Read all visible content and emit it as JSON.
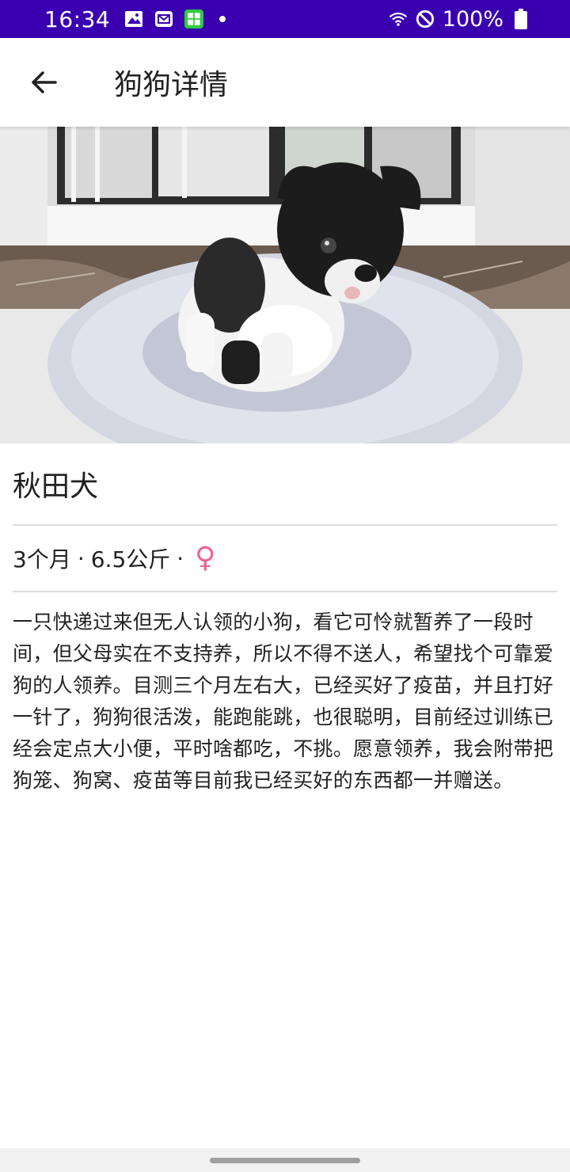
{
  "status_bar": {
    "time": "16:34",
    "battery": "100%",
    "background": "#3a00b0",
    "icons": [
      "image-icon",
      "mail-icon",
      "app-icon",
      "wifi-icon",
      "dnd-icon",
      "battery-icon"
    ]
  },
  "app_bar": {
    "title": "狗狗详情",
    "back_icon": "arrow-left-icon"
  },
  "dog": {
    "name": "秋田犬",
    "age": "3个月",
    "weight": "6.5公斤",
    "separator": "·",
    "gender_symbol": "♀",
    "gender_color": "#f06292",
    "description": "一只快递过来但无人认领的小狗，看它可怜就暂养了一段时间，但父母实在不支持养，所以不得不送人，希望找个可靠爱狗的人领养。目测三个月左右大，已经买好了疫苗，并且打好一针了，狗狗很活泼，能跑能跳，也很聪明，目前经过训练已经会定点大小便，平时啥都吃，不挑。愿意领养，我会附带把狗笼、狗窝、疫苗等目前我已经买好的东西都一并赠送。"
  }
}
